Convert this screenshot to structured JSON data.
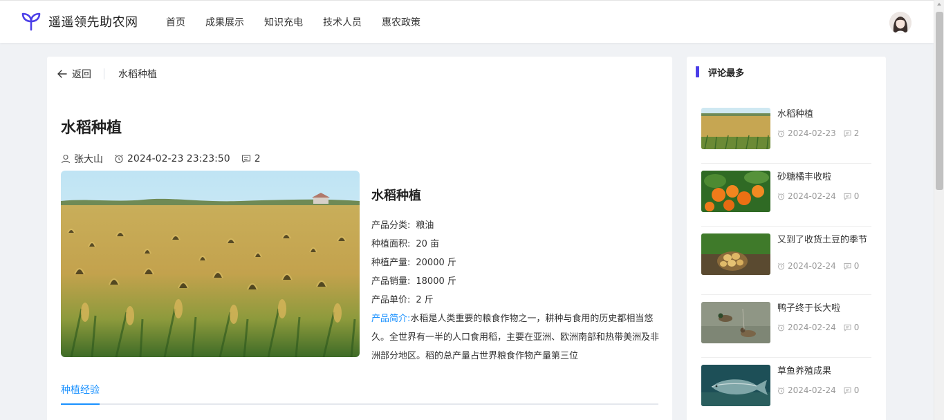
{
  "site": {
    "name": "遥遥领先助农网",
    "nav": [
      "首页",
      "成果展示",
      "知识充电",
      "技术人员",
      "惠农政策"
    ]
  },
  "breadcrumb": {
    "back_label": "返回",
    "current": "水稻种植"
  },
  "article": {
    "title": "水稻种植",
    "author": "张大山",
    "datetime": "2024-02-23 23:23:50",
    "comments": "2",
    "product": {
      "name": "水稻种植",
      "fields": [
        {
          "label": "产品分类:",
          "value": "粮油"
        },
        {
          "label": "种植面积:",
          "value": "20 亩"
        },
        {
          "label": "种植产量:",
          "value": "20000 斤"
        },
        {
          "label": "产品销量:",
          "value": "18000 斤"
        },
        {
          "label": "产品单价:",
          "value": "2 斤"
        }
      ],
      "intro_label": "产品简介:",
      "intro_text": "水稻是人类重要的粮食作物之一，耕种与食用的历史都相当悠久。全世界有一半的人口食用稻，主要在亚洲、欧洲南部和热带美洲及非洲部分地区。稻的总产量占世界粮食作物产量第三位"
    },
    "tab_label": "种植经验"
  },
  "sidebar": {
    "title": "评论最多",
    "items": [
      {
        "title": "水稻种植",
        "date": "2024-02-23",
        "comments": "2"
      },
      {
        "title": "砂糖橘丰收啦",
        "date": "2024-02-24",
        "comments": "0"
      },
      {
        "title": "又到了收货土豆的季节",
        "date": "2024-02-24",
        "comments": "0"
      },
      {
        "title": "鸭子终于长大啦",
        "date": "2024-02-24",
        "comments": "0"
      },
      {
        "title": "草鱼养殖成果",
        "date": "2024-02-24",
        "comments": "0"
      }
    ]
  },
  "colors": {
    "accent": "#1890ff",
    "brand": "#4b3ee8"
  }
}
